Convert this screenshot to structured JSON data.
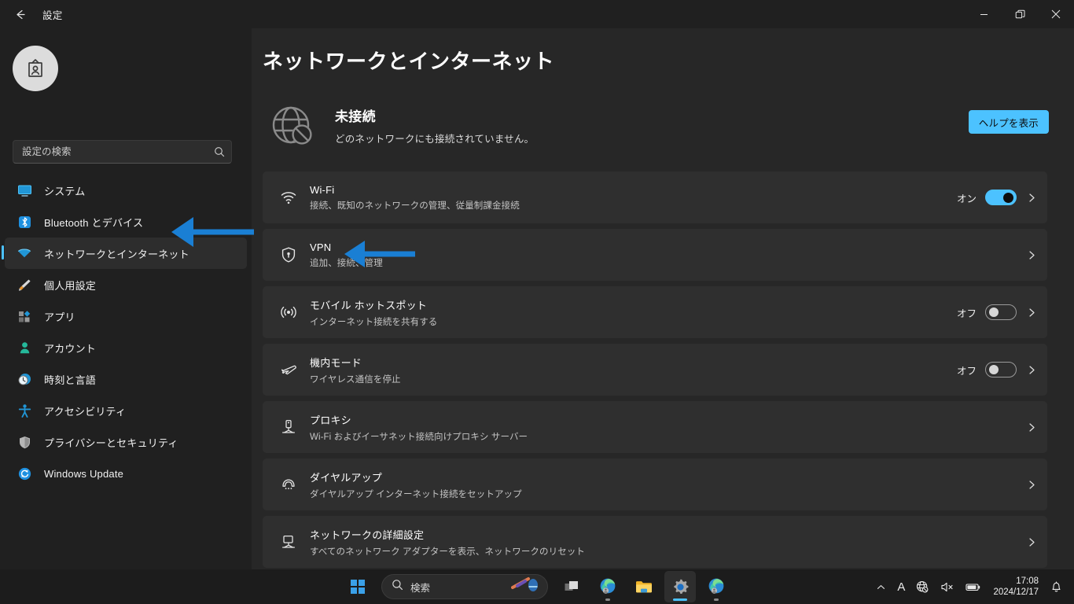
{
  "window": {
    "title": "設定",
    "back_label": "戻る",
    "minimize_label": "最小化",
    "restore_label": "元に戻す",
    "close_label": "閉じる"
  },
  "sidebar": {
    "profile": {
      "name": "",
      "email": "",
      "avatar_icon": "id-badge-icon"
    },
    "search": {
      "placeholder": "設定の検索",
      "value": "",
      "icon": "search-icon"
    },
    "items": [
      {
        "label": "システム",
        "icon": "system-icon",
        "active": false
      },
      {
        "label": "Bluetooth とデバイス",
        "icon": "bluetooth-icon",
        "active": false
      },
      {
        "label": "ネットワークとインターネット",
        "icon": "network-icon",
        "active": true
      },
      {
        "label": "個人用設定",
        "icon": "personalization-brush-icon",
        "active": false
      },
      {
        "label": "アプリ",
        "icon": "apps-icon",
        "active": false
      },
      {
        "label": "アカウント",
        "icon": "account-person-icon",
        "active": false
      },
      {
        "label": "時刻と言語",
        "icon": "time-language-clock-icon",
        "active": false
      },
      {
        "label": "アクセシビリティ",
        "icon": "accessibility-person-icon",
        "active": false
      },
      {
        "label": "プライバシーとセキュリティ",
        "icon": "shield-privacy-icon",
        "active": false
      },
      {
        "label": "Windows Update",
        "icon": "windows-update-refresh-icon",
        "active": false
      }
    ]
  },
  "main": {
    "page_title": "ネットワークとインターネット",
    "status": {
      "icon": "globe-disconnected-icon",
      "title": "未接続",
      "subtitle": "どのネットワークにも接続されていません。",
      "help_button": "ヘルプを表示"
    },
    "cards": [
      {
        "icon": "wifi-icon",
        "title": "Wi-Fi",
        "subtitle": "接続、既知のネットワークの管理、従量制課金接続",
        "toggle": {
          "visible": true,
          "state_label": "オン",
          "on": true
        },
        "chevron": true
      },
      {
        "icon": "vpn-shield-icon",
        "title": "VPN",
        "subtitle": "追加、接続、管理",
        "toggle": {
          "visible": false,
          "state_label": "",
          "on": false
        },
        "chevron": true
      },
      {
        "icon": "mobile-hotspot-icon",
        "title": "モバイル ホットスポット",
        "subtitle": "インターネット接続を共有する",
        "toggle": {
          "visible": true,
          "state_label": "オフ",
          "on": false
        },
        "chevron": true
      },
      {
        "icon": "airplane-mode-icon",
        "title": "機内モード",
        "subtitle": "ワイヤレス通信を停止",
        "toggle": {
          "visible": true,
          "state_label": "オフ",
          "on": false
        },
        "chevron": true
      },
      {
        "icon": "proxy-server-icon",
        "title": "プロキシ",
        "subtitle": "Wi-Fi およびイーサネット接続向けプロキシ サーバー",
        "toggle": {
          "visible": false,
          "state_label": "",
          "on": false
        },
        "chevron": true
      },
      {
        "icon": "dialup-phone-icon",
        "title": "ダイヤルアップ",
        "subtitle": "ダイヤルアップ インターネット接続をセットアップ",
        "toggle": {
          "visible": false,
          "state_label": "",
          "on": false
        },
        "chevron": true
      },
      {
        "icon": "advanced-network-monitor-icon",
        "title": "ネットワークの詳細設定",
        "subtitle": "すべてのネットワーク アダプターを表示、ネットワークのリセット",
        "toggle": {
          "visible": false,
          "state_label": "",
          "on": false
        },
        "chevron": true
      }
    ]
  },
  "annotations": {
    "arrow_color": "#1a7fd4",
    "arrows": [
      {
        "name": "arrow-pointing-to-network-sidebar-item",
        "target": "ネットワークとインターネット"
      },
      {
        "name": "arrow-pointing-to-vpn-card",
        "target": "VPN"
      }
    ]
  },
  "taskbar": {
    "start_label": "スタート",
    "search": {
      "placeholder": "検索",
      "icon": "search-icon"
    },
    "buttons": [
      {
        "name": "task-view-button",
        "label": "タスク ビュー"
      },
      {
        "name": "edge-button",
        "label": "Microsoft Edge"
      },
      {
        "name": "file-explorer-button",
        "label": "エクスプローラー"
      },
      {
        "name": "settings-button",
        "label": "設定"
      },
      {
        "name": "edge-second-button",
        "label": "Microsoft Edge"
      }
    ],
    "tray": {
      "chevron_label": "隠れているインジケーターを表示",
      "ime_label": "A",
      "network_icon": "globe-disconnected-icon",
      "volume_icon": "speaker-muted-icon",
      "battery_icon": "battery-icon",
      "time": "17:08",
      "date": "2024/12/17",
      "notification_icon": "bell-icon"
    }
  },
  "colors": {
    "accent": "#4cc2ff",
    "arrow": "#1a7fd4",
    "window_bg": "#202020",
    "content_bg": "#272727",
    "card_bg": "#2f2f2f",
    "taskbar_bg": "#1c1c1c"
  }
}
